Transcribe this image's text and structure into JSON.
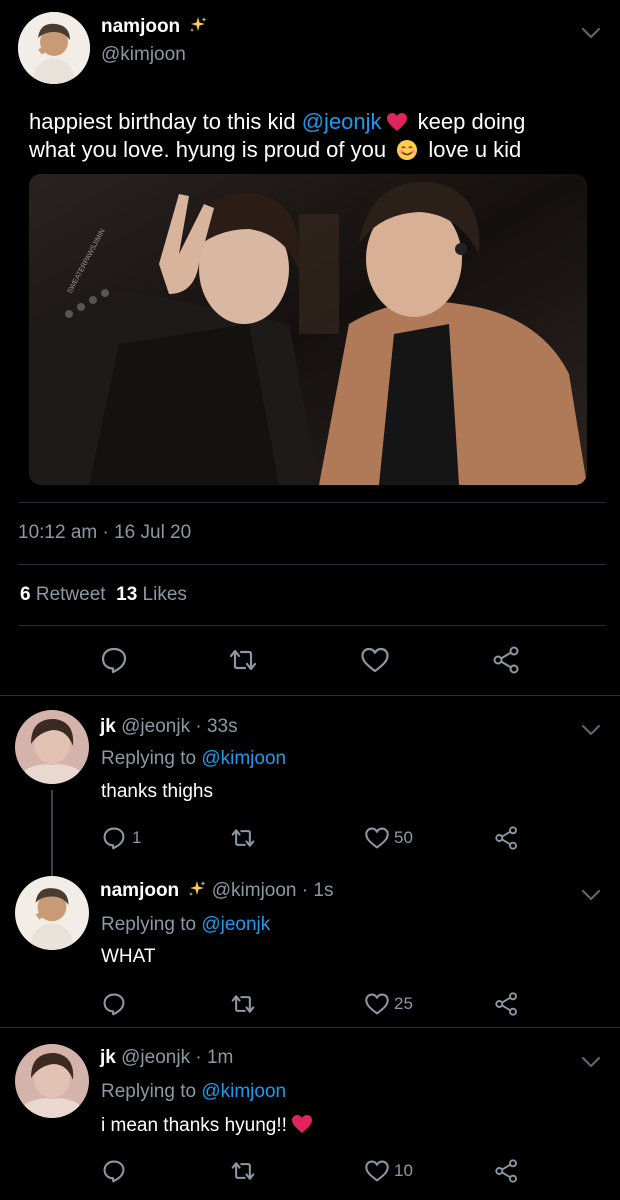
{
  "main_tweet": {
    "display_name": "namjoon",
    "handle": "@kimjoon",
    "text_part1": "happiest birthday to this kid ",
    "mention": "@jeonjk",
    "text_part2": " keep doing",
    "text_line2a": "what you love. hyung is proud of you ",
    "text_line2b": " love u kid",
    "photo_watermark": "SWEATERPAWSJIMIN",
    "timestamp": "10:12 am · 16 Jul 20",
    "retweets_count": "6",
    "retweets_label": "Retweet",
    "likes_count": "13",
    "likes_label": "Likes"
  },
  "replies": [
    {
      "display_name": "jk",
      "handle_time": "@jeonjk · 33s",
      "replying_label": "Replying to",
      "replying_to": "@kimjoon",
      "text": "thanks thighs",
      "reply_count": "1",
      "like_count": "50"
    },
    {
      "display_name": "namjoon",
      "handle_time": "@kimjoon · 1s",
      "replying_label": "Replying to",
      "replying_to": "@jeonjk",
      "text": "WHAT",
      "reply_count": "",
      "like_count": "25"
    },
    {
      "display_name": "jk",
      "handle_time": "@jeonjk · 1m",
      "replying_label": "Replying to",
      "replying_to": "@kimjoon",
      "text": "i mean thanks hyung!!",
      "reply_count": "",
      "like_count": "10"
    }
  ],
  "icons": {
    "reply": "reply-icon",
    "retweet": "retweet-icon",
    "like": "heart-icon",
    "share": "share-icon",
    "more": "chevron-down-icon",
    "verified_style": "sparkles-icon"
  },
  "colors": {
    "background": "#000000",
    "link": "#1d9bf0",
    "muted": "#8b98a5",
    "heart_emoji": "#e0245e",
    "sparkle": "#ffcc4d"
  }
}
